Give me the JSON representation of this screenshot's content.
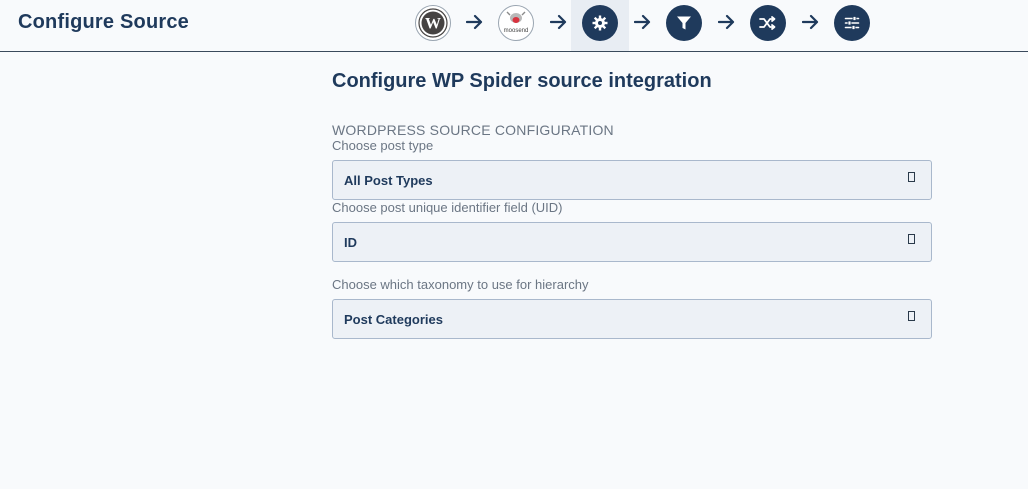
{
  "header": {
    "title": "Configure Source",
    "steps": [
      {
        "name": "wordpress-logo-icon",
        "active": false
      },
      {
        "name": "moosend-logo-icon",
        "label": "moosend",
        "active": false
      },
      {
        "name": "gear-icon",
        "active": true
      },
      {
        "name": "filter-icon",
        "active": false
      },
      {
        "name": "shuffle-icon",
        "active": false
      },
      {
        "name": "sliders-icon",
        "active": false
      }
    ]
  },
  "main": {
    "heading": "Configure WP Spider source integration",
    "section_title": "WORDPRESS SOURCE CONFIGURATION",
    "fields": [
      {
        "label": "Choose post type",
        "value": "All Post Types"
      },
      {
        "label": "Choose post unique identifier field (UID)",
        "value": "ID"
      },
      {
        "label": "Choose which taxonomy to use for hierarchy",
        "value": "Post Categories"
      }
    ]
  },
  "colors": {
    "primary": "#1f3a5c",
    "background": "#f8fafc",
    "select_bg": "#edf1f6",
    "select_border": "#a9b8cc",
    "muted_text": "#6b7684"
  }
}
